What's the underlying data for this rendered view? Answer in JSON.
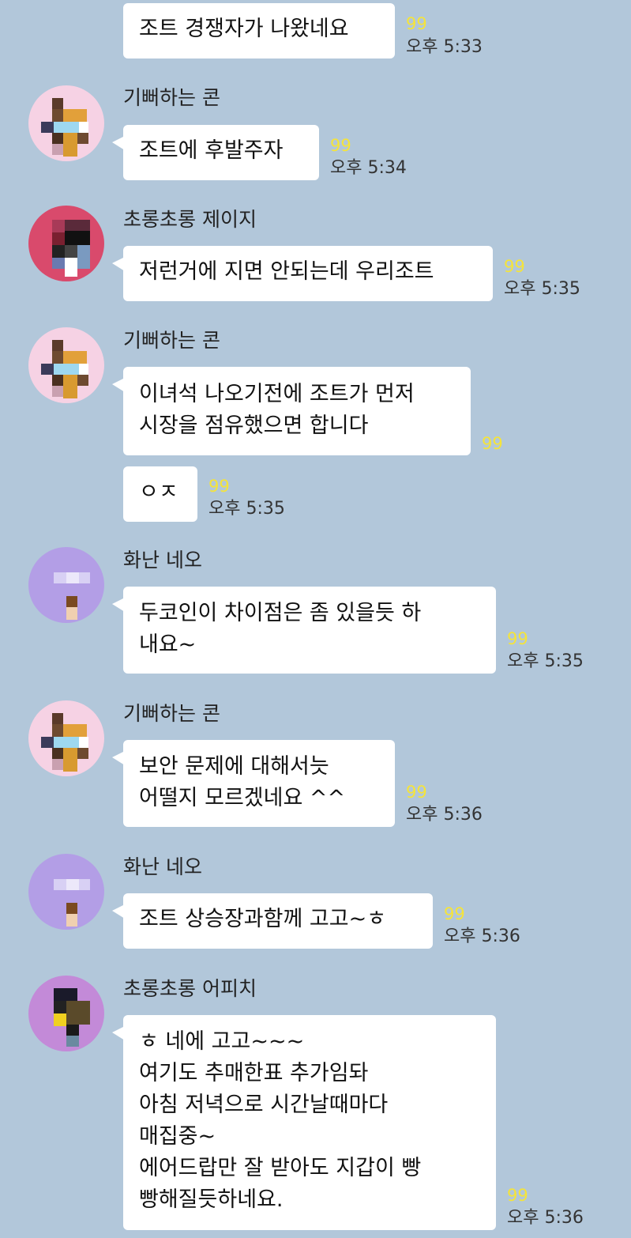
{
  "messages": [
    {
      "text": "조트 경쟁자가 나왔네요",
      "unread": "99",
      "time": "오후 5:33"
    },
    {
      "sender": "기뻐하는 콘",
      "text": "조트에 후발주자",
      "unread": "99",
      "time": "오후 5:34"
    },
    {
      "sender": "초롱초롱 제이지",
      "text": "저런거에 지면 안되는데 우리조트",
      "unread": "99",
      "time": "오후 5:35"
    },
    {
      "sender": "기뻐하는 콘",
      "lines": [
        "이녀석 나오기전에 조트가 먼저",
        "시장을  점유했으면 합니다"
      ],
      "unread": "99"
    },
    {
      "text": "ㅇㅈ",
      "unread": "99",
      "time": "오후 5:35"
    },
    {
      "sender": "화난 네오",
      "lines": [
        "두코인이 차이점은 좀 있을듯 하",
        "내요~"
      ],
      "unread": "99",
      "time": "오후 5:35"
    },
    {
      "sender": "기뻐하는 콘",
      "lines": [
        "보안 문제에 대해서늣",
        "어떨지 모르겠네요   ^^"
      ],
      "unread": "99",
      "time": "오후 5:36"
    },
    {
      "sender": "화난 네오",
      "text": "조트 상승장과함께 고고~ㅎ",
      "unread": "99",
      "time": "오후 5:36"
    },
    {
      "sender": "초롱초롱 어피치",
      "lines": [
        "ㅎ 네에 고고~~~",
        "여기도 추매한표 추가임돠",
        "아침 저녁으로 시간날때마다",
        "매집중~",
        "에어드랍만 잘 받아도 지갑이 빵",
        "빵해질듯하네요."
      ],
      "unread": "99",
      "time": "오후 5:36"
    }
  ]
}
